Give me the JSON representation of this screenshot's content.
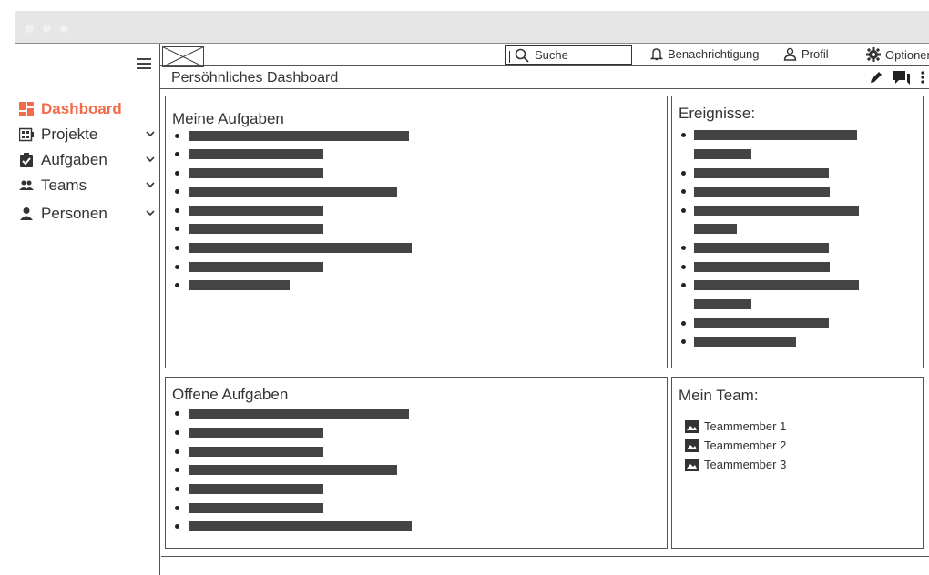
{
  "sidebar": {
    "items": [
      {
        "label": "Dashboard",
        "icon": "dashboard-icon",
        "active": true
      },
      {
        "label": "Projekte",
        "icon": "projects-icon"
      },
      {
        "label": "Aufgaben",
        "icon": "tasks-icon"
      },
      {
        "label": "Teams",
        "icon": "teams-icon"
      },
      {
        "label": "Personen",
        "icon": "person-icon"
      }
    ]
  },
  "topbar": {
    "search_placeholder": "Suche",
    "notifications": "Benachrichtigung",
    "profile": "Profil",
    "options": "Optionen"
  },
  "page": {
    "title": "Persöhnliches Dashboard"
  },
  "panels": {
    "my_tasks": {
      "title": "Meine Aufgaben"
    },
    "events": {
      "title": "Ereignisse:"
    },
    "open_tasks": {
      "title": "Offene Aufgaben"
    },
    "my_team": {
      "title": "Mein Team:",
      "members": [
        "Teammember 1",
        "Teammember 2",
        "Teammember 3"
      ]
    }
  },
  "colors": {
    "accent": "#f26b4b",
    "placeholder_bar": "#444444",
    "border": "#555555"
  }
}
